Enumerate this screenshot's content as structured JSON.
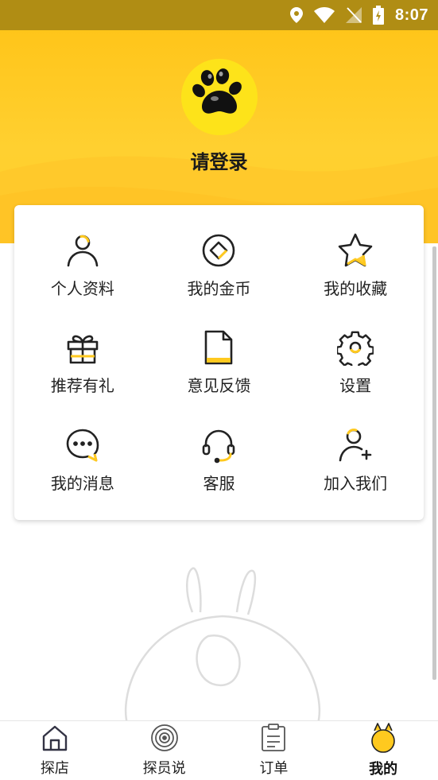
{
  "status_bar": {
    "time": "8:07"
  },
  "profile": {
    "login_label": "请登录"
  },
  "menu": {
    "items": [
      {
        "label": "个人资料",
        "icon": "user-icon"
      },
      {
        "label": "我的金币",
        "icon": "coin-icon"
      },
      {
        "label": "我的收藏",
        "icon": "star-icon"
      },
      {
        "label": "推荐有礼",
        "icon": "gift-icon"
      },
      {
        "label": "意见反馈",
        "icon": "document-icon"
      },
      {
        "label": "设置",
        "icon": "gear-icon"
      },
      {
        "label": "我的消息",
        "icon": "chat-icon"
      },
      {
        "label": "客服",
        "icon": "headset-icon"
      },
      {
        "label": "加入我们",
        "icon": "add-user-icon"
      }
    ]
  },
  "tabbar": {
    "items": [
      {
        "label": "探店",
        "icon": "home-icon"
      },
      {
        "label": "探员说",
        "icon": "record-icon"
      },
      {
        "label": "订单",
        "icon": "clipboard-icon"
      },
      {
        "label": "我的",
        "icon": "mascot-icon",
        "active": true
      }
    ]
  },
  "colors": {
    "accent": "#FFC91F",
    "status_bar": "#B08D14",
    "text": "#222222"
  }
}
